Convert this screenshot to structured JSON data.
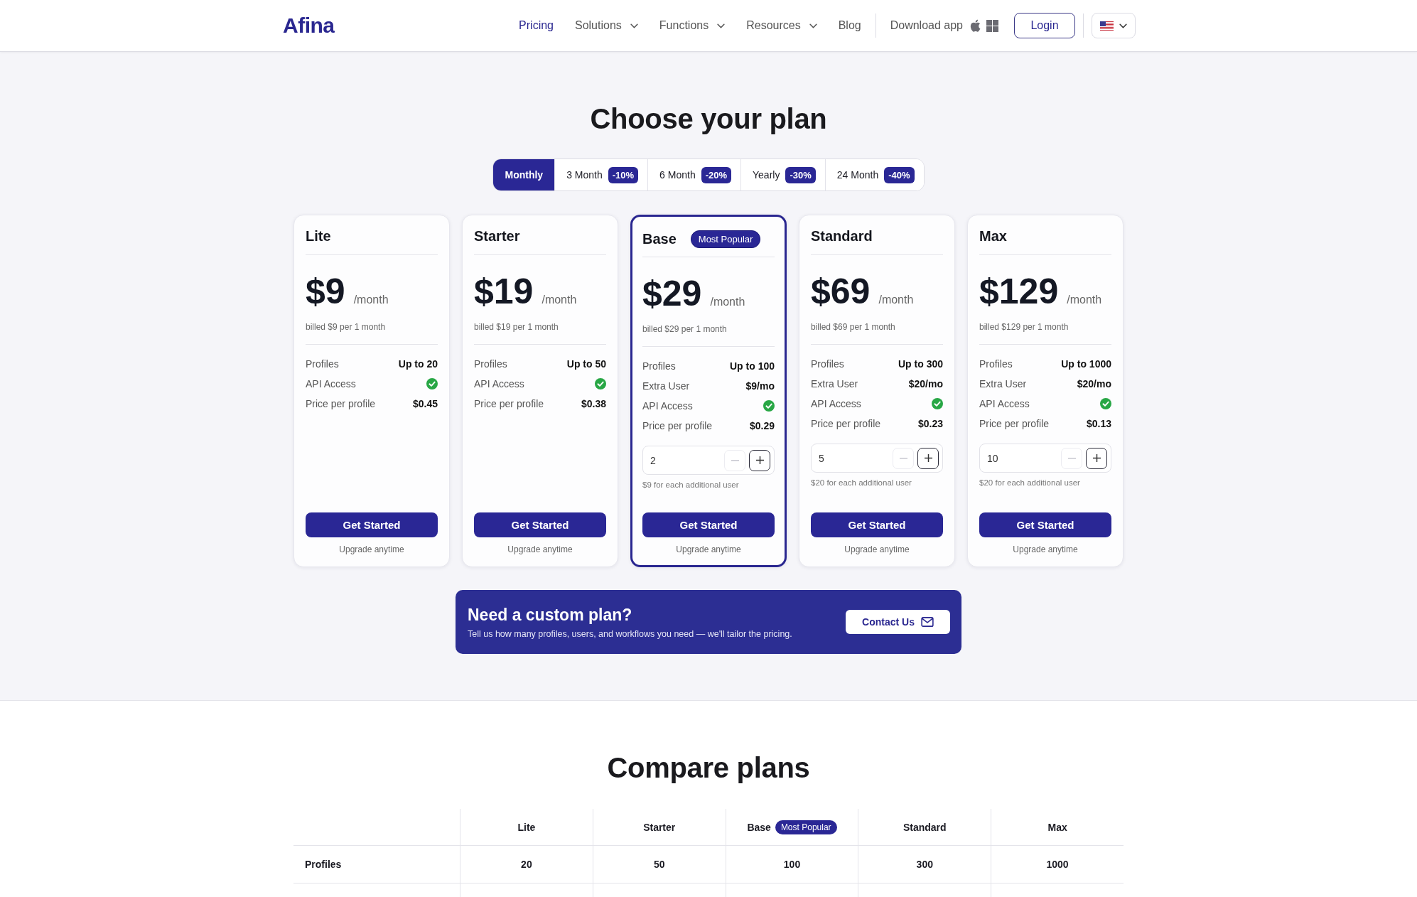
{
  "header": {
    "logo": "Afina",
    "nav": [
      {
        "label": "Pricing",
        "selected": true,
        "dropdown": false
      },
      {
        "label": "Solutions",
        "selected": false,
        "dropdown": true
      },
      {
        "label": "Functions",
        "selected": false,
        "dropdown": true
      },
      {
        "label": "Resources",
        "selected": false,
        "dropdown": true
      },
      {
        "label": "Blog",
        "selected": false,
        "dropdown": false
      }
    ],
    "download_label": "Download app",
    "login": "Login"
  },
  "title": "Choose your plan",
  "billing_tabs": [
    {
      "label": "Monthly",
      "selected": true
    },
    {
      "label": "3 Month",
      "badge": "-10%",
      "selected": false
    },
    {
      "label": "6 Month",
      "badge": "-20%",
      "selected": false
    },
    {
      "label": "Yearly",
      "badge": "-30%",
      "selected": false
    },
    {
      "label": "24 Month",
      "badge": "-40%",
      "selected": false
    }
  ],
  "plans": [
    {
      "name": "Lite",
      "featured": false,
      "price": "$9",
      "period": "/month",
      "billed": "billed $9 per 1 month",
      "features": [
        {
          "kind": "text",
          "label": "Profiles",
          "value": "Up to 20"
        },
        {
          "kind": "check",
          "label": "API Access",
          "checked": true
        },
        {
          "kind": "text",
          "label": "Price per profile",
          "value": "$0.45"
        }
      ],
      "button": "Get Started",
      "footnote": "Upgrade anytime"
    },
    {
      "name": "Starter",
      "featured": false,
      "price": "$19",
      "period": "/month",
      "billed": "billed $19 per 1 month",
      "features": [
        {
          "kind": "text",
          "label": "Profiles",
          "value": "Up to 50"
        },
        {
          "kind": "check",
          "label": "API Access",
          "checked": true
        },
        {
          "kind": "text",
          "label": "Price per profile",
          "value": "$0.38"
        }
      ],
      "button": "Get Started",
      "footnote": "Upgrade anytime"
    },
    {
      "name": "Base",
      "badge": "Most Popular",
      "featured": true,
      "price": "$29",
      "period": "/month",
      "billed": "billed $29 per 1 month",
      "features": [
        {
          "kind": "text",
          "label": "Profiles",
          "value": "Up to 100"
        },
        {
          "kind": "text",
          "label": "Extra User",
          "value": "$9/mo"
        },
        {
          "kind": "check",
          "label": "API Access",
          "checked": true
        },
        {
          "kind": "text",
          "label": "Price per profile",
          "value": "$0.29"
        }
      ],
      "seats": {
        "value": "2",
        "decrement_disabled": true,
        "note": "$9 for each additional user"
      },
      "button": "Get Started",
      "footnote": "Upgrade anytime"
    },
    {
      "name": "Standard",
      "featured": false,
      "price": "$69",
      "period": "/month",
      "billed": "billed $69 per 1 month",
      "features": [
        {
          "kind": "text",
          "label": "Profiles",
          "value": "Up to 300"
        },
        {
          "kind": "text",
          "label": "Extra User",
          "value": "$20/mo"
        },
        {
          "kind": "check",
          "label": "API Access",
          "checked": true
        },
        {
          "kind": "text",
          "label": "Price per profile",
          "value": "$0.23"
        }
      ],
      "seats": {
        "value": "5",
        "decrement_disabled": true,
        "note": "$20 for each additional user"
      },
      "button": "Get Started",
      "footnote": "Upgrade anytime"
    },
    {
      "name": "Max",
      "featured": false,
      "price": "$129",
      "period": "/month",
      "billed": "billed $129 per 1 month",
      "features": [
        {
          "kind": "text",
          "label": "Profiles",
          "value": "Up to 1000"
        },
        {
          "kind": "text",
          "label": "Extra User",
          "value": "$20/mo"
        },
        {
          "kind": "check",
          "label": "API Access",
          "checked": true
        },
        {
          "kind": "text",
          "label": "Price per profile",
          "value": "$0.13"
        }
      ],
      "seats": {
        "value": "10",
        "decrement_disabled": true,
        "note": "$20 for each additional user"
      },
      "button": "Get Started",
      "footnote": "Upgrade anytime"
    }
  ],
  "custom_plan": {
    "title": "Need a custom plan?",
    "text": "Tell us how many profiles, users, and workflows you need — we'll tailor the pricing.",
    "button": "Contact Us"
  },
  "compare": {
    "title": "Compare plans",
    "columns": [
      {
        "label": "Lite"
      },
      {
        "label": "Starter"
      },
      {
        "label": "Base",
        "badge": "Most Popular"
      },
      {
        "label": "Standard"
      },
      {
        "label": "Max"
      }
    ],
    "rows": [
      {
        "label": "Profiles",
        "cells": [
          "20",
          "50",
          "100",
          "300",
          "1000"
        ]
      }
    ]
  }
}
